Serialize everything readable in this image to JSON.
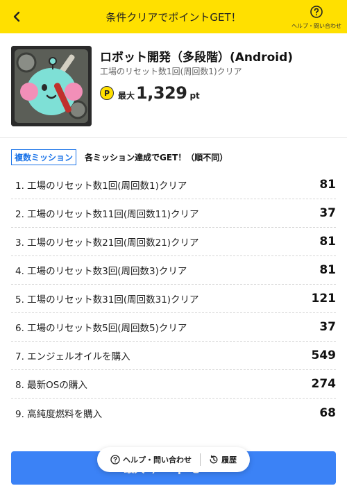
{
  "header": {
    "title": "条件クリアでポイントGET！",
    "help_label": "ヘルプ・問い合わせ"
  },
  "app": {
    "title": "ロボット開発（多段階）(Android)",
    "subtitle": "工場のリセット数1回(周回数1)クリア",
    "points_badge": "P",
    "points_prefix": "最大",
    "points_value": "1,329",
    "points_unit": "pt"
  },
  "missions": {
    "tag": "複数ミッション",
    "description": "各ミッション達成でGET！（順不同）",
    "items": [
      {
        "label": "1. 工場のリセット数1回(周回数1)クリア",
        "points": "81"
      },
      {
        "label": "2. 工場のリセット数11回(周回数11)クリア",
        "points": "37"
      },
      {
        "label": "3. 工場のリセット数21回(周回数21)クリア",
        "points": "81"
      },
      {
        "label": "4. 工場のリセット数3回(周回数3)クリア",
        "points": "81"
      },
      {
        "label": "5. 工場のリセット数31回(周回数31)クリア",
        "points": "121"
      },
      {
        "label": "6. 工場のリセット数5回(周回数5)クリア",
        "points": "37"
      },
      {
        "label": "7. エンジェルオイルを購入",
        "points": "549"
      },
      {
        "label": "8. 最新OSの購入",
        "points": "274"
      },
      {
        "label": "9. 高純度燃料を購入",
        "points": "68"
      }
    ]
  },
  "cta": {
    "label": "最大1,329ptをGET"
  },
  "float_bar": {
    "help_label": "ヘルプ・問い合わせ",
    "history_label": "履歴"
  },
  "colors": {
    "header_bg": "#ffe000",
    "accent_blue": "#1a73e8",
    "cta_bg": "#3b82f6"
  },
  "icons": {
    "back": "chevron-left-icon",
    "help": "question-circle-icon",
    "history": "history-clock-icon"
  }
}
